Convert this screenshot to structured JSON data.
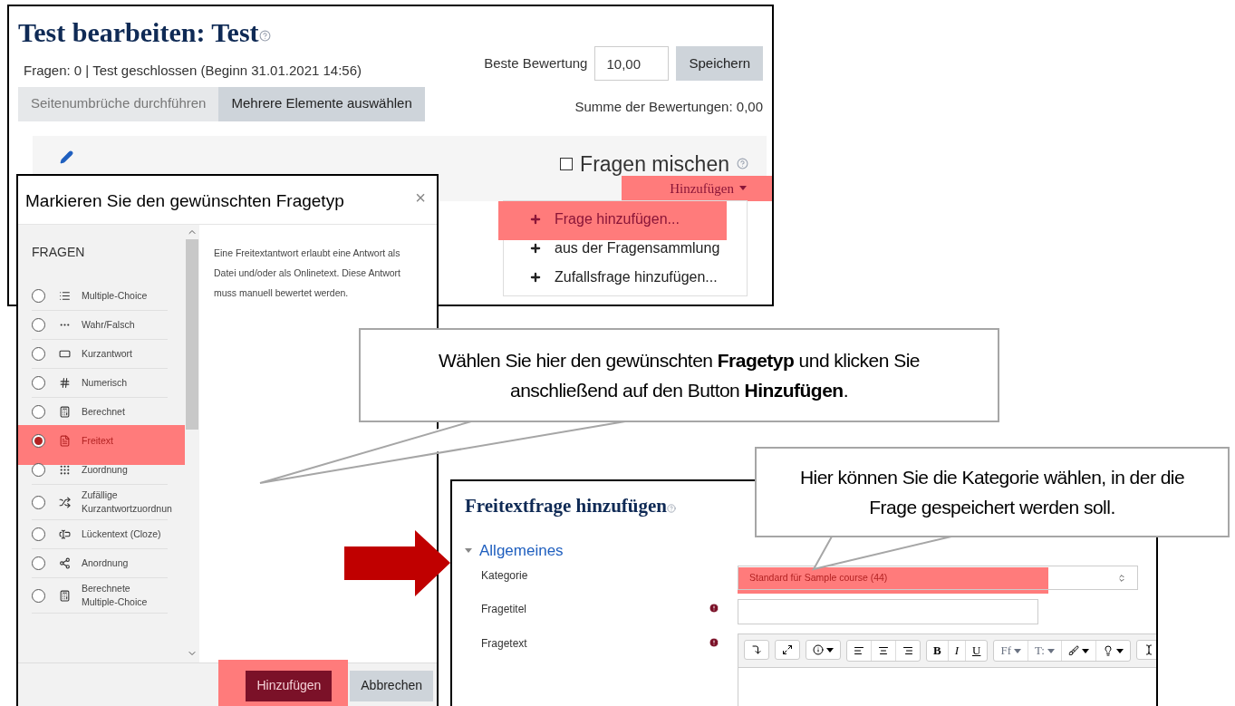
{
  "quiz_page": {
    "title": "Test bearbeiten: Test",
    "info": "Fragen: 0 | Test geschlossen (Beginn 31.01.2021 14:56)",
    "max_grade": {
      "label": "Beste Bewertung",
      "value": "10,00"
    },
    "save_button": "Speichern",
    "buttons": [
      {
        "label": "Seitenumbrüche durchführen",
        "disabled": true
      },
      {
        "label": "Mehrere Elemente auswählen",
        "disabled": false
      }
    ],
    "total": "Summe der Bewertungen: 0,00",
    "shuffle": {
      "label": "Fragen mischen",
      "checked": false
    },
    "add_toggle": {
      "label": "Hinzufügen",
      "highlighted": true
    },
    "add_menu": [
      {
        "label": "Frage hinzufügen...",
        "highlighted": true
      },
      {
        "label": "aus der Fragensammlung",
        "highlighted": false
      },
      {
        "label": "Zufallsfrage hinzufügen...",
        "highlighted": false
      }
    ]
  },
  "chooser": {
    "title": "Markieren Sie den gewünschten Fragetyp",
    "close": "×",
    "section": "FRAGEN",
    "types": [
      {
        "label": "Multiple-Choice",
        "selected": false,
        "highlighted": false
      },
      {
        "label": "Wahr/Falsch",
        "selected": false,
        "highlighted": false
      },
      {
        "label": "Kurzantwort",
        "selected": false,
        "highlighted": false
      },
      {
        "label": "Numerisch",
        "selected": false,
        "highlighted": false
      },
      {
        "label": "Berechnet",
        "selected": false,
        "highlighted": false
      },
      {
        "label": "Freitext",
        "selected": true,
        "highlighted": true
      },
      {
        "label": "Zuordnung",
        "selected": false,
        "highlighted": false
      },
      {
        "label": "Zufällige Kurzantwortzuordnun",
        "selected": false,
        "highlighted": false
      },
      {
        "label": "Lückentext (Cloze)",
        "selected": false,
        "highlighted": false
      },
      {
        "label": "Anordnung",
        "selected": false,
        "highlighted": false
      },
      {
        "label": "Berechnete Multiple-Choice",
        "selected": false,
        "highlighted": false
      }
    ],
    "description": "Eine Freitextantwort erlaubt eine Antwort als Datei und/oder als Onlinetext. Diese Antwort muss manuell bewertet werden.",
    "footer_buttons": [
      {
        "label": "Hinzufügen",
        "kind": "primary",
        "highlighted": true
      },
      {
        "label": "Abbrechen",
        "kind": "secondary",
        "highlighted": false
      }
    ]
  },
  "callouts": [
    {
      "text": "Wählen Sie hier den gewünschten **Fragetyp** und klicken Sie anschließend auf den Button **Hinzufügen**."
    },
    {
      "text": "Hier können Sie die Kategorie wählen, in der die Frage gespeichert werden soll."
    }
  ],
  "form": {
    "title": "Freitextfrage hinzufügen",
    "section": {
      "label": "Allgemeines",
      "expanded": true
    },
    "fields": [
      {
        "label": "Kategorie",
        "kind": "select",
        "value": "Standard für Sample course (44)",
        "required": false,
        "highlighted": true
      },
      {
        "label": "Fragetitel",
        "kind": "input",
        "required": true,
        "highlighted": false
      },
      {
        "label": "Fragetext",
        "kind": "editor",
        "required": true,
        "highlighted": false
      }
    ],
    "toolbar_labels": [
      "B",
      "I",
      "U",
      "Ff",
      "T:"
    ]
  }
}
